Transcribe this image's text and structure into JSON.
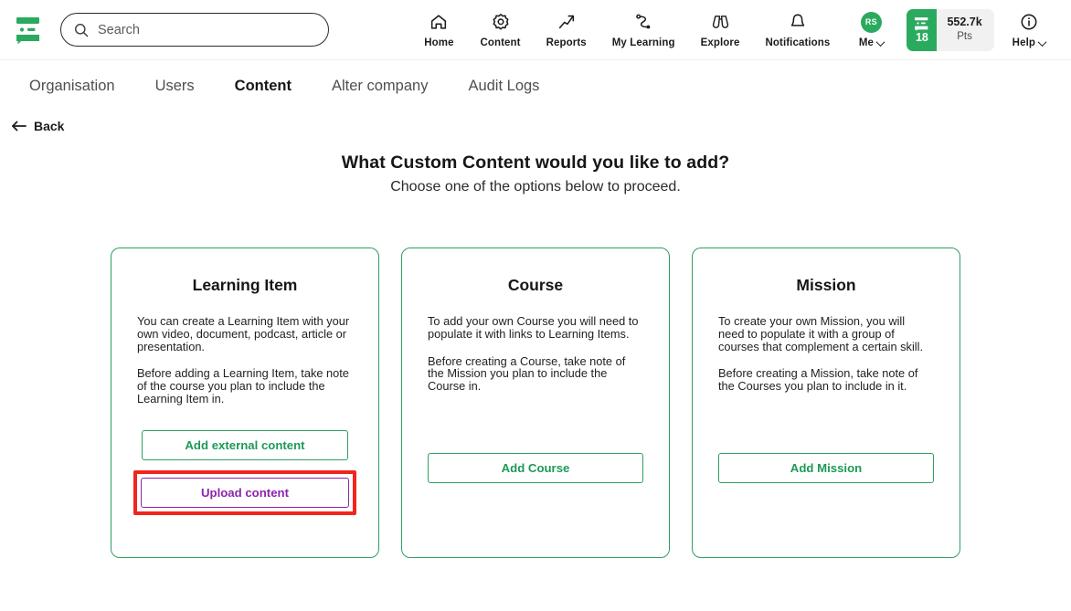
{
  "header": {
    "logo_alt": "quiz-bubble-logo",
    "search": {
      "placeholder": "Search",
      "value": "",
      "icon": "search-icon"
    },
    "nav": [
      {
        "label": "Home",
        "icon": "home-icon"
      },
      {
        "label": "Content",
        "icon": "gear-icon"
      },
      {
        "label": "Reports",
        "icon": "trending-up-arrow-icon"
      },
      {
        "label": "My Learning",
        "icon": "path-route-icon"
      },
      {
        "label": "Explore",
        "icon": "binoculars-icon"
      },
      {
        "label": "Notifications",
        "icon": "bell-icon"
      }
    ],
    "me": {
      "label": "Me",
      "initials": "RS",
      "caret": "chevron-down-icon"
    },
    "points": {
      "level": "18",
      "value": "552.7k",
      "unit": "Pts"
    },
    "help": {
      "label": "Help",
      "icon": "info-circle-icon",
      "caret": "chevron-down-icon"
    }
  },
  "tabs": [
    {
      "label": "Organisation",
      "active": false
    },
    {
      "label": "Users",
      "active": false
    },
    {
      "label": "Content",
      "active": true
    },
    {
      "label": "Alter company",
      "active": false
    },
    {
      "label": "Audit Logs",
      "active": false
    }
  ],
  "back": {
    "label": "Back",
    "icon": "arrow-left-icon"
  },
  "page": {
    "heading": "What Custom Content would you like to add?",
    "subheading": "Choose one of the options below to proceed."
  },
  "cards": [
    {
      "title": "Learning Item",
      "para1": "You can create a Learning Item with your own video, document, podcast, article or presentation.",
      "para2": "Before adding a Learning Item, take note of the course you plan to include the Learning Item in.",
      "button1": "Add external content",
      "button2": "Upload content",
      "highlighted_button": "Upload content"
    },
    {
      "title": "Course",
      "para1": "To add your own Course you will need to populate it with links to Learning Items.",
      "para2": "Before creating a Course, take note of the Mission you plan to include the Course in.",
      "button1": "Add Course"
    },
    {
      "title": "Mission",
      "para1": "To create your own Mission, you will need to populate it with a group of courses that complement a certain skill.",
      "para2": "Before creating a Mission, take note of the Courses you plan to include in it.",
      "button1": "Add Mission"
    }
  ],
  "colors": {
    "brand_green": "#2aaa5e",
    "card_border_green": "#2f9e63",
    "button_green_text": "#1d9a56",
    "purple": "#8e24aa",
    "highlight_red": "#f1251c"
  }
}
